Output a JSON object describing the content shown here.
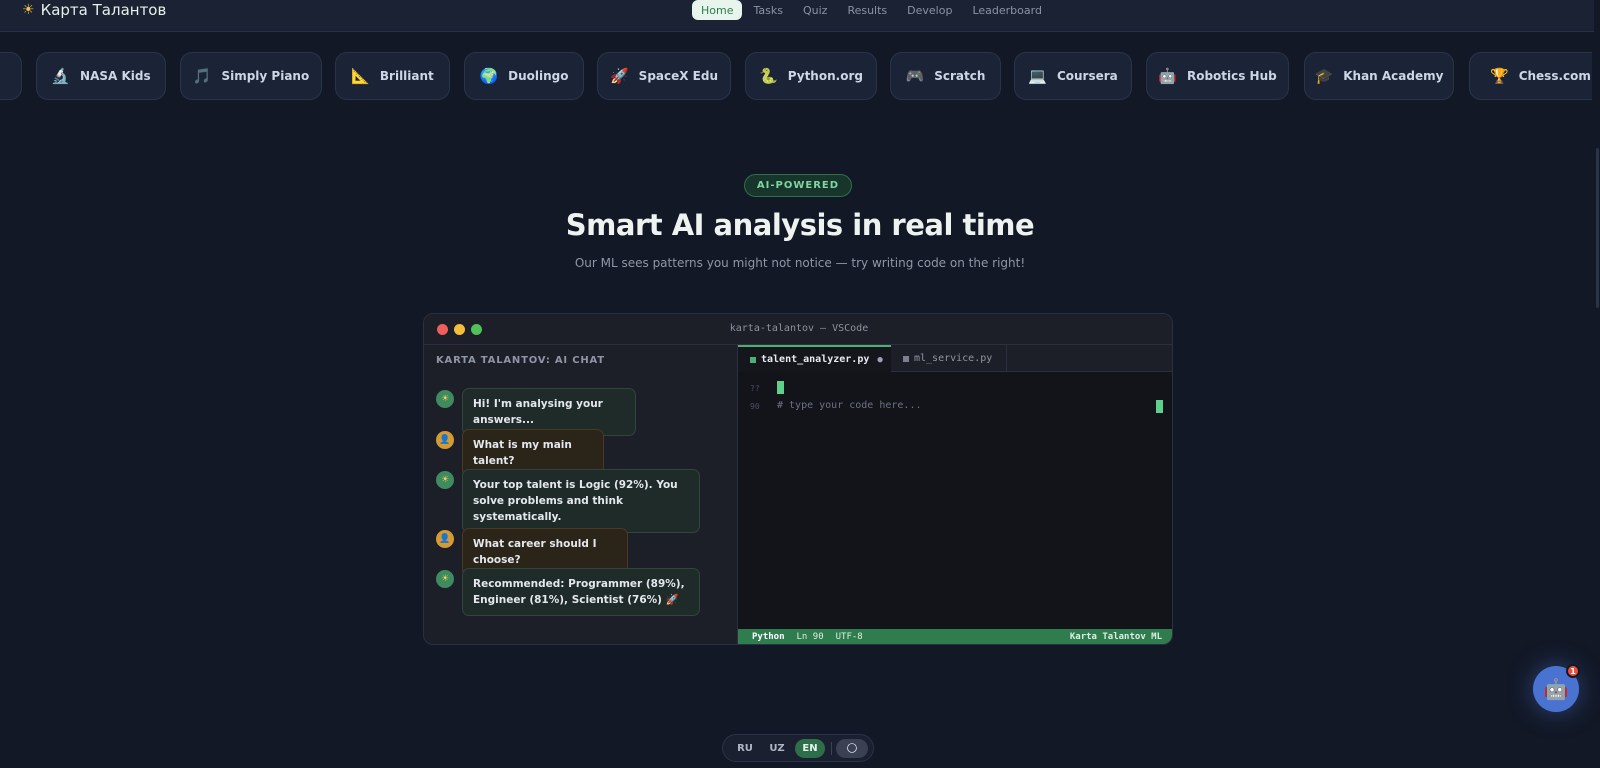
{
  "header": {
    "brand": "Карта Талантов",
    "nav": [
      "Home",
      "Tasks",
      "Quiz",
      "Results",
      "Develop",
      "Leaderboard"
    ],
    "active": "Home"
  },
  "partners": [
    {
      "label": "NASA Kids",
      "icon": "🔬"
    },
    {
      "label": "Simply Piano",
      "icon": "🎵"
    },
    {
      "label": "Brilliant",
      "icon": "📐"
    },
    {
      "label": "Duolingo",
      "icon": "🌍"
    },
    {
      "label": "SpaceX Edu",
      "icon": "🚀"
    },
    {
      "label": "Python.org",
      "icon": "🐍"
    },
    {
      "label": "Scratch",
      "icon": "🎮"
    },
    {
      "label": "Coursera",
      "icon": "💻"
    },
    {
      "label": "Robotics Hub",
      "icon": "🤖"
    },
    {
      "label": "Khan Academy",
      "icon": "🎓"
    },
    {
      "label": "Chess.com",
      "icon": "🏆"
    }
  ],
  "hero": {
    "badge": "AI-POWERED",
    "title": "Smart AI analysis in real time",
    "subtitle": "Our ML sees patterns you might not notice — try writing code on the right!"
  },
  "window": {
    "title": "karta-talantov — VSCode",
    "chat": {
      "header": "KARTA TALANTOV: AI CHAT",
      "messages": [
        {
          "role": "ai",
          "text": "Hi! I'm analysing your answers..."
        },
        {
          "role": "user",
          "text": "What is my main talent?"
        },
        {
          "role": "ai",
          "text": "Your top talent is Logic (92%). You solve problems and think systematically."
        },
        {
          "role": "user",
          "text": "What career should I choose?"
        },
        {
          "role": "ai",
          "text": "Recommended: Programmer (89%), Engineer (81%), Scientist (76%) 🚀"
        }
      ]
    },
    "editor": {
      "tabs": [
        {
          "label": "talent_analyzer.py",
          "modified": "●"
        },
        {
          "label": "ml_service.py"
        }
      ],
      "line_numbers": [
        "??",
        "90"
      ],
      "code": "# type your code here...",
      "status": {
        "language": "Python",
        "line": "Ln 90",
        "encoding": "UTF-8",
        "right": "Karta Talantov ML"
      }
    }
  },
  "bot": {
    "icon": "🤖",
    "badge": "1"
  },
  "languages": [
    "RU",
    "UZ",
    "EN"
  ],
  "active_language": "EN",
  "theme_icon": "🌕",
  "colors": {
    "accent": "#2f7d4f",
    "background": "#121826"
  }
}
